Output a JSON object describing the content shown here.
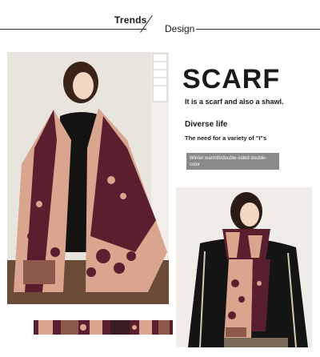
{
  "header": {
    "left_label": "Trends",
    "right_label": "Design"
  },
  "product": {
    "title": "SCARF",
    "subtitle": "It is a scarf and also a shawl.",
    "section_title": "Diverse life",
    "section_body": "The need for a variety of \"I\"s",
    "badge_text": "Winter warmth/double-sided double-color"
  },
  "colors": {
    "accent_dark": "#5a1f2e",
    "accent_pink": "#d9a58e",
    "badge_bg": "#8a8a8a"
  }
}
